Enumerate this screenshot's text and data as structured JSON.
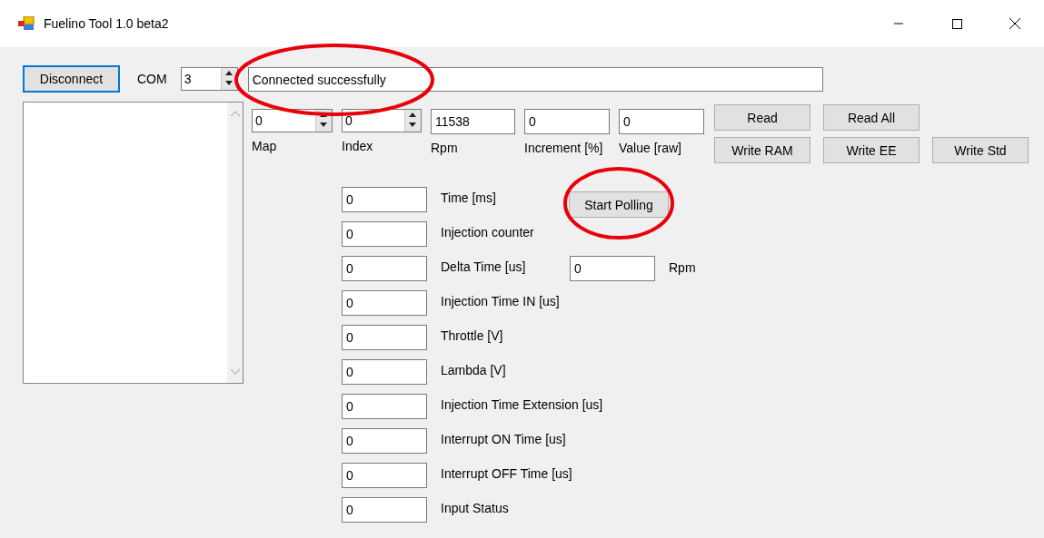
{
  "window": {
    "title": "Fuelino Tool 1.0 beta2"
  },
  "connection": {
    "button": {
      "label": "Disconnect",
      "focused": true
    },
    "port_label": "COM",
    "port": "3",
    "status": "Connected successfully",
    "status_highlighted": true
  },
  "parameters": [
    {
      "kind": "spin",
      "value": "0",
      "label": "Map"
    },
    {
      "kind": "spin",
      "value": "0",
      "label": "Index"
    },
    {
      "kind": "text",
      "value": "11538",
      "label": "Rpm"
    },
    {
      "kind": "text",
      "value": "0",
      "label": "Increment [%]"
    },
    {
      "kind": "text",
      "value": "0",
      "label": "Value [raw]"
    }
  ],
  "action_rows": [
    {
      "buttons": [
        "Read",
        "Read All"
      ]
    },
    {
      "buttons": [
        "Write RAM",
        "Write EE",
        "Write Std"
      ]
    }
  ],
  "measurements": [
    {
      "value": "0",
      "label": "Time [ms]",
      "button": {
        "label": "Start Polling",
        "highlighted": true
      }
    },
    {
      "value": "0",
      "label": "Injection counter"
    },
    {
      "value": "0",
      "label": "Delta Time [us]",
      "extra_field": {
        "value": "0",
        "label": "Rpm"
      }
    },
    {
      "value": "0",
      "label": "Injection Time IN [us]"
    },
    {
      "value": "0",
      "label": "Throttle [V]"
    },
    {
      "value": "0",
      "label": "Lambda [V]"
    },
    {
      "value": "0",
      "label": "Injection Time Extension [us]"
    },
    {
      "value": "0",
      "label": "Interrupt ON Time [us]"
    },
    {
      "value": "0",
      "label": "Interrupt OFF Time [us]"
    },
    {
      "value": "0",
      "label": "Input Status"
    }
  ]
}
